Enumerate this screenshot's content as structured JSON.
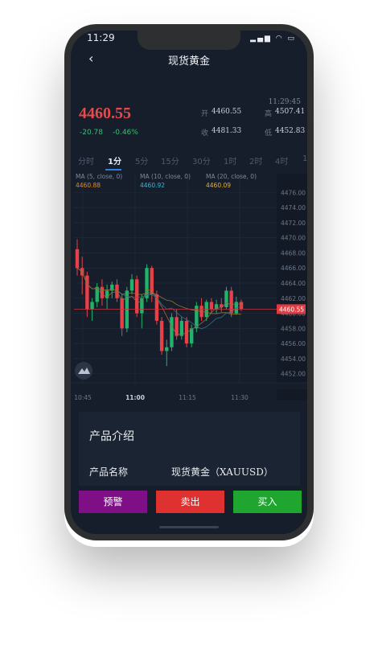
{
  "status": {
    "time": "11:29",
    "icons": "▂▄▆ ◠ ▭"
  },
  "nav": {
    "back_icon": "‹",
    "title": "现货黄金"
  },
  "quote": {
    "time": "11:29:45",
    "price": "4460.55",
    "change": "-20.78",
    "change_pct": "-0.46%",
    "open_label": "开",
    "open": "4460.55",
    "high_label": "高",
    "high": "4507.41",
    "close_label": "收",
    "close": "4481.33",
    "low_label": "低",
    "low": "4452.83"
  },
  "tabs": [
    "分时",
    "1分",
    "5分",
    "15分",
    "30分",
    "1时",
    "2时",
    "4时",
    "1"
  ],
  "active_tab": 1,
  "chart_data": {
    "type": "candlestick",
    "ma_legend": [
      {
        "label": "MA (5, close, 0)",
        "value": "4460.88",
        "color": "#e88a1a"
      },
      {
        "label": "MA (10, close, 0)",
        "value": "4460.92",
        "color": "#39b6d8"
      },
      {
        "label": "MA (20, close, 0)",
        "value": "4460.09",
        "color": "#e6b020"
      }
    ],
    "yticks": [
      "4476.00",
      "4474.00",
      "4472.00",
      "4470.00",
      "4468.00",
      "4466.00",
      "4464.00",
      "4462.00",
      "4460.00",
      "4458.00",
      "4456.00",
      "4454.00",
      "4452.00"
    ],
    "ylim": [
      4451,
      4477
    ],
    "xticks": [
      "10:45",
      "11:00",
      "11:15",
      "11:30"
    ],
    "current_price": "4460.55",
    "up_color": "#22b36a",
    "down_color": "#e84049",
    "candles": [
      [
        4468.5,
        4469.8,
        4465.0,
        4466.0
      ],
      [
        4466.0,
        4467.5,
        4462.5,
        4465.0
      ],
      [
        4465.0,
        4465.5,
        4459.5,
        4460.5
      ],
      [
        4460.5,
        4462.0,
        4459.0,
        4461.5
      ],
      [
        4461.5,
        4464.0,
        4460.8,
        4463.5
      ],
      [
        4463.5,
        4464.5,
        4461.0,
        4462.0
      ],
      [
        4462.0,
        4463.8,
        4460.5,
        4463.0
      ],
      [
        4463.0,
        4464.2,
        4462.0,
        4463.8
      ],
      [
        4463.8,
        4464.5,
        4461.5,
        4462.0
      ],
      [
        4462.0,
        4462.5,
        4457.0,
        4458.0
      ],
      [
        4458.0,
        4463.5,
        4457.5,
        4463.0
      ],
      [
        4463.0,
        4465.2,
        4462.5,
        4464.5
      ],
      [
        4464.5,
        4465.0,
        4459.5,
        4460.0
      ],
      [
        4460.0,
        4462.5,
        4458.0,
        4462.0
      ],
      [
        4462.0,
        4466.5,
        4461.5,
        4466.0
      ],
      [
        4466.0,
        4466.3,
        4461.5,
        4462.5
      ],
      [
        4462.5,
        4463.0,
        4458.5,
        4459.0
      ],
      [
        4459.0,
        4459.5,
        4454.5,
        4455.0
      ],
      [
        4455.0,
        4456.5,
        4453.0,
        4455.5
      ],
      [
        4455.5,
        4460.0,
        4455.0,
        4459.5
      ],
      [
        4459.5,
        4460.5,
        4456.5,
        4457.0
      ],
      [
        4457.0,
        4459.5,
        4456.5,
        4459.0
      ],
      [
        4459.0,
        4459.5,
        4455.5,
        4456.0
      ],
      [
        4456.0,
        4458.5,
        4455.5,
        4458.0
      ],
      [
        4458.0,
        4461.5,
        4457.5,
        4461.0
      ],
      [
        4461.0,
        4462.0,
        4459.0,
        4459.5
      ],
      [
        4459.5,
        4461.8,
        4459.0,
        4461.5
      ],
      [
        4461.5,
        4462.0,
        4460.0,
        4460.5
      ],
      [
        4460.5,
        4461.8,
        4460.0,
        4461.2
      ],
      [
        4461.2,
        4462.0,
        4460.2,
        4460.8
      ],
      [
        4460.8,
        4463.5,
        4460.5,
        4463.0
      ],
      [
        4463.0,
        4463.5,
        4459.5,
        4460.0
      ],
      [
        4460.0,
        4462.2,
        4459.8,
        4461.5
      ],
      [
        4461.5,
        4461.8,
        4460.3,
        4460.55
      ]
    ]
  },
  "intro": {
    "title": "产品介绍",
    "name_label": "产品名称",
    "name_value": "现货黄金（XAUUSD）"
  },
  "actions": {
    "alert": "预警",
    "sell": "卖出",
    "buy": "买入"
  }
}
